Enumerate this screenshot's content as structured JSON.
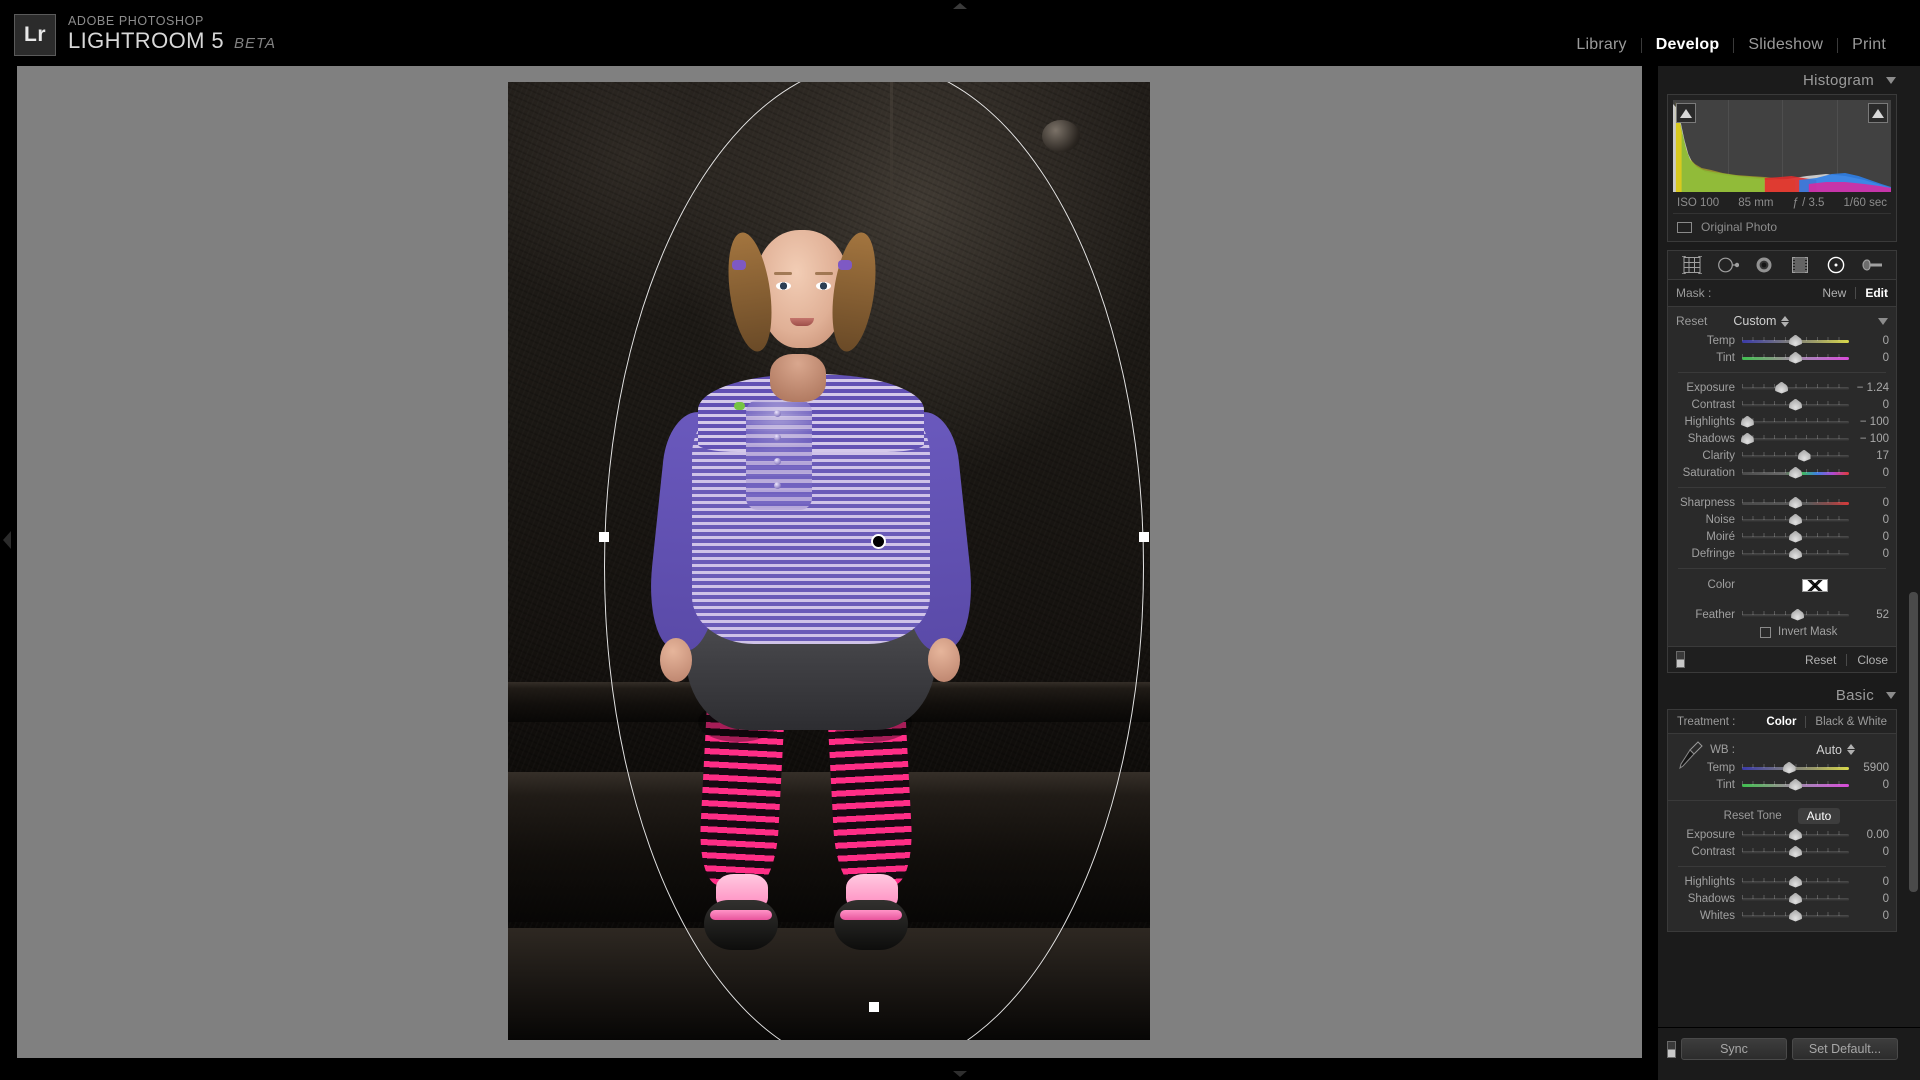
{
  "app": {
    "badge": "Lr",
    "suite": "ADOBE PHOTOSHOP",
    "name": "LIGHTROOM 5",
    "edition": "BETA"
  },
  "modules": [
    {
      "label": "Library",
      "active": false
    },
    {
      "label": "Develop",
      "active": true
    },
    {
      "label": "Slideshow",
      "active": false
    },
    {
      "label": "Print",
      "active": false
    }
  ],
  "histogram": {
    "title": "Histogram",
    "shadow_clip_icon": "triangle-up-icon",
    "highlight_clip_icon": "triangle-up-icon",
    "meta": {
      "iso": "ISO 100",
      "focal": "85 mm",
      "aperture": "ƒ / 3.5",
      "shutter": "1/60 sec"
    },
    "original_photo": "Original Photo"
  },
  "toolstrip": [
    {
      "name": "crop-overlay-tool",
      "active": false
    },
    {
      "name": "spot-removal-tool",
      "active": false
    },
    {
      "name": "red-eye-correction-tool",
      "active": false
    },
    {
      "name": "graduated-filter-tool",
      "active": false
    },
    {
      "name": "radial-filter-tool",
      "active": true
    },
    {
      "name": "adjustment-brush-tool",
      "active": false
    }
  ],
  "mask": {
    "label": "Mask :",
    "new_label": "New",
    "edit_label": "Edit"
  },
  "radial": {
    "reset_label": "Reset",
    "preset_label": "Custom",
    "color_label": "Color",
    "color_swatch": "#ffffff",
    "feather": {
      "label": "Feather",
      "value": "52",
      "pos": 52,
      "type": "plain"
    },
    "invert_label": "Invert Mask",
    "invert_checked": false,
    "footer": {
      "reset": "Reset",
      "close": "Close"
    },
    "wb_sliders": [
      {
        "label": "Temp",
        "value": "0",
        "pos": 50,
        "type": "temp"
      },
      {
        "label": "Tint",
        "value": "0",
        "pos": 50,
        "type": "tint"
      }
    ],
    "tone_sliders": [
      {
        "label": "Exposure",
        "value": "− 1.24",
        "pos": 37,
        "type": "plain"
      },
      {
        "label": "Contrast",
        "value": "0",
        "pos": 50,
        "type": "plain"
      },
      {
        "label": "Highlights",
        "value": "− 100",
        "pos": 5,
        "type": "plain"
      },
      {
        "label": "Shadows",
        "value": "− 100",
        "pos": 5,
        "type": "plain"
      },
      {
        "label": "Clarity",
        "value": "17",
        "pos": 58,
        "type": "plain"
      },
      {
        "label": "Saturation",
        "value": "0",
        "pos": 50,
        "type": "saturation"
      }
    ],
    "detail_sliders": [
      {
        "label": "Sharpness",
        "value": "0",
        "pos": 50,
        "type": "sharpness"
      },
      {
        "label": "Noise",
        "value": "0",
        "pos": 50,
        "type": "plain"
      },
      {
        "label": "Moiré",
        "value": "0",
        "pos": 50,
        "type": "plain"
      },
      {
        "label": "Defringe",
        "value": "0",
        "pos": 50,
        "type": "plain"
      }
    ]
  },
  "basic": {
    "title": "Basic",
    "treatment_label": "Treatment :",
    "treatment_color": "Color",
    "treatment_bw": "Black & White",
    "wb_label": "WB :",
    "wb_value": "Auto",
    "wb_sliders": [
      {
        "label": "Temp",
        "value": "5900",
        "pos": 44,
        "type": "temp"
      },
      {
        "label": "Tint",
        "value": "0",
        "pos": 50,
        "type": "tint"
      }
    ],
    "reset_tone": "Reset Tone",
    "auto": "Auto",
    "tone_sliders": [
      {
        "label": "Exposure",
        "value": "0.00",
        "pos": 50,
        "type": "plain"
      },
      {
        "label": "Contrast",
        "value": "0",
        "pos": 50,
        "type": "plain"
      }
    ],
    "tone_sliders2": [
      {
        "label": "Highlights",
        "value": "0",
        "pos": 50,
        "type": "plain"
      },
      {
        "label": "Shadows",
        "value": "0",
        "pos": 50,
        "type": "plain"
      },
      {
        "label": "Whites",
        "value": "0",
        "pos": 50,
        "type": "plain"
      }
    ]
  },
  "footer": {
    "sync": "Sync",
    "set_default": "Set Default..."
  },
  "colors": {
    "canvas_bg": "#808080",
    "panel_bg": "#1b1b1b",
    "accent_text": "#ffffff"
  }
}
